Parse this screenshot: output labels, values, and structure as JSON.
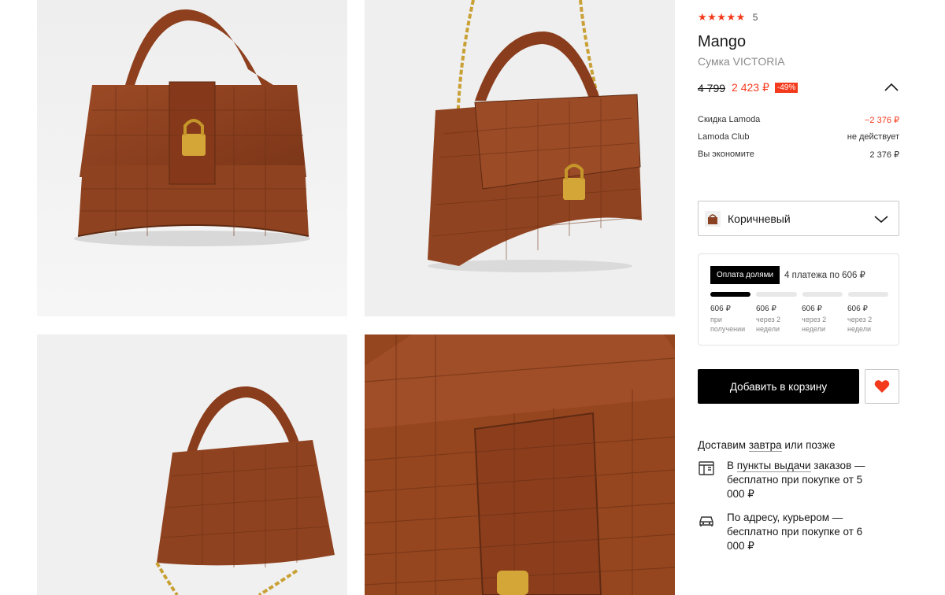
{
  "rating": {
    "stars": "★★★★★",
    "count": "5"
  },
  "product": {
    "brand": "Mango",
    "name": "Сумка VICTORIA"
  },
  "price": {
    "old": "4 799",
    "new": "2 423 ₽",
    "discount": "-49%"
  },
  "breakdown": [
    {
      "label": "Скидка Lamoda",
      "value": "−2 376 ₽"
    },
    {
      "label": "Lamoda Club",
      "value": "не действует"
    },
    {
      "label": "Вы экономите",
      "value": "2 376 ₽"
    }
  ],
  "color": {
    "selected": "Коричневый"
  },
  "split_payment": {
    "badge": "Оплата долями",
    "summary": "4 платежа по 606 ₽",
    "payments": [
      {
        "amount": "606 ₽",
        "when": "при\nполучении"
      },
      {
        "amount": "606 ₽",
        "when": "через 2\nнедели"
      },
      {
        "amount": "606 ₽",
        "when": "через 2\nнедели"
      },
      {
        "amount": "606 ₽",
        "when": "через 2\nнедели"
      }
    ],
    "paid_count": 1
  },
  "actions": {
    "add_to_cart": "Добавить в корзину"
  },
  "delivery": {
    "prefix": "Доставим ",
    "link": "завтра",
    "suffix": " или позже",
    "pickup": {
      "prefix": "В ",
      "link": "пункты выдачи",
      "suffix": " заказов — бесплатно при покупке от 5 000 ₽"
    },
    "courier": {
      "text": "По адресу, курьером — бесплатно при покупке от 6 000 ₽"
    }
  },
  "colors": {
    "accent": "#f33a1c",
    "leather": "#8a4022",
    "button": "#000000"
  }
}
